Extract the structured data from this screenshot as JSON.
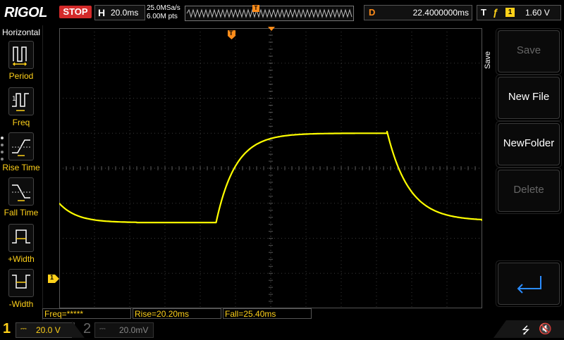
{
  "header": {
    "logo_text": "RIGOL",
    "run_state": "STOP",
    "timebase_letter": "H",
    "timebase_value": "20.0ms",
    "sample_rate": "25.0MSa/s",
    "memory_depth": "6.00M pts",
    "trigger_pos_glyph": "T",
    "delay_letter": "D",
    "delay_value": "22.4000000ms",
    "trigger_letter": "T",
    "trigger_edge_glyph": "ƒ",
    "trigger_channel": "1",
    "trigger_level": "1.60 V"
  },
  "left_menu": {
    "title": "Horizontal",
    "items": [
      {
        "label": "Period",
        "icon": "period-icon"
      },
      {
        "label": "Freq",
        "icon": "frequency-icon"
      },
      {
        "label": "Rise Time",
        "icon": "rise-time-icon"
      },
      {
        "label": "Fall Time",
        "icon": "fall-time-icon"
      },
      {
        "label": "+Width",
        "icon": "positive-width-icon"
      },
      {
        "label": "-Width",
        "icon": "negative-width-icon"
      }
    ]
  },
  "screen": {
    "trigger_marker": "T",
    "ch1_marker": "1",
    "trace_color": "#ffff00",
    "waveform": {
      "base_level_divs": 2.45,
      "high_level_divs": 5.0,
      "rise_start_divs": 4.45,
      "fall_start_divs": 9.3
    }
  },
  "right_panel": {
    "section_label": "Save",
    "buttons": [
      {
        "label": "Save",
        "enabled": false
      },
      {
        "label": "New File",
        "enabled": true
      },
      {
        "label": "NewFolder",
        "enabled": true
      },
      {
        "label": "Delete",
        "enabled": false
      }
    ],
    "enter_icon": "enter-icon"
  },
  "measurements": {
    "freq": "Freq=*****",
    "rise": "Rise=20.20ms",
    "fall": "Fall=25.40ms"
  },
  "channels": {
    "ch1": {
      "number": "1",
      "coupling": "⎓",
      "scale": "20.0 V",
      "color": "#ffd11a"
    },
    "ch2": {
      "number": "2",
      "coupling": "⎓",
      "scale": "20.0mV",
      "color": "#666666"
    }
  },
  "colors": {
    "stop": "#d42a2a",
    "ch1": "#ffd11a",
    "trigger": "#ff8c1a",
    "grid": "#3a3a3a"
  }
}
